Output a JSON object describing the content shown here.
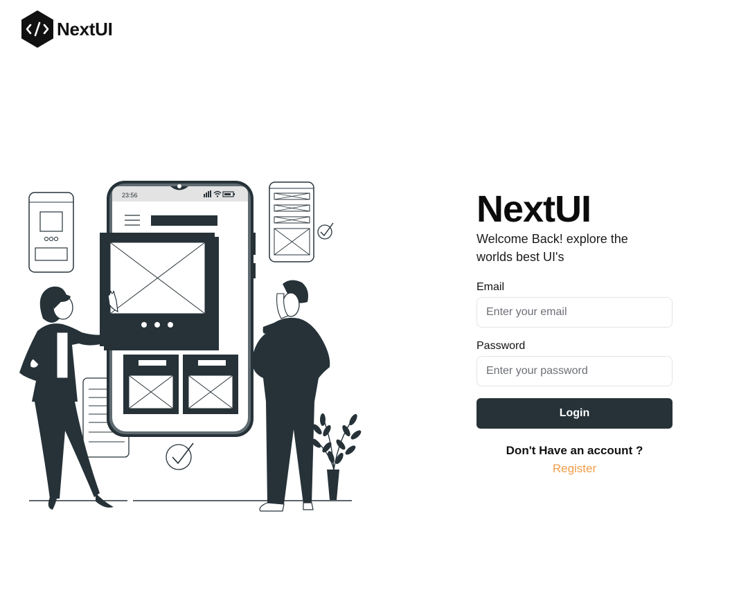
{
  "header": {
    "brand": "NextUI",
    "logo_icon": "code-brackets-hexagon-icon"
  },
  "illustration": {
    "phone_time": "23:56",
    "icons": [
      "signal-icon",
      "wifi-icon",
      "battery-icon",
      "menu-icon",
      "checkmark-icon"
    ]
  },
  "login": {
    "title": "NextUI",
    "subtitle": "Welcome Back! explore the worlds best UI's",
    "email_label": "Email",
    "email_placeholder": "Enter your email",
    "email_value": "",
    "password_label": "Password",
    "password_placeholder": "Enter your password",
    "password_value": "",
    "submit_label": "Login",
    "account_question": "Don't Have an account ?",
    "register_label": "Register"
  },
  "colors": {
    "primary": "#263238",
    "link": "#f29d49",
    "input_border": "#e1e4e8"
  }
}
